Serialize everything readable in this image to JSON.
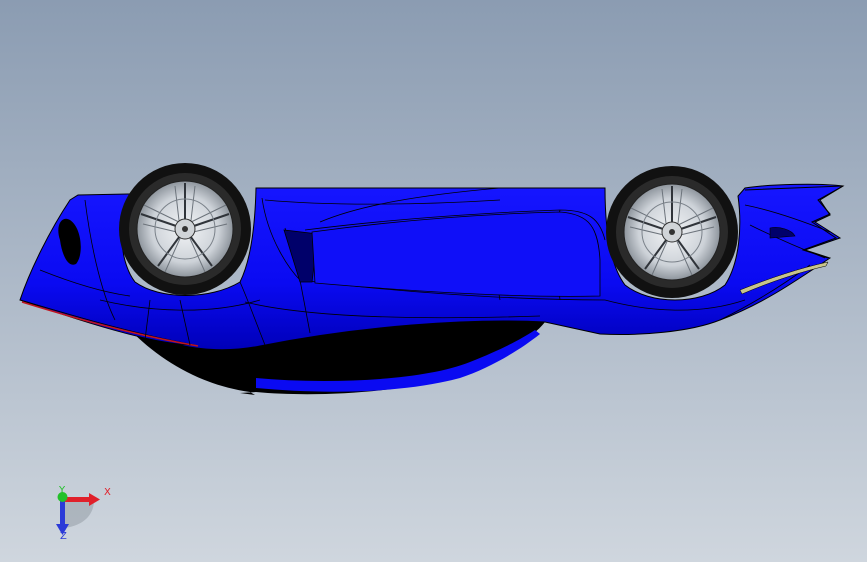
{
  "viewport": {
    "background_top": "#8b9cb2",
    "background_bottom": "#cfd6de",
    "model": {
      "name": "car-model",
      "body_color": "#0a0af2",
      "body_shadow": "#0000a6",
      "underside": "#000000",
      "edge_color": "#000000",
      "accent_line": "#c0141e",
      "side_strip": "#c8c48c",
      "tire_color": "#111111",
      "rim_color": "#d9dde2"
    }
  },
  "triad": {
    "x_label": "X",
    "y_label": "Y",
    "z_label": "Z",
    "x_color": "#e0202a",
    "y_color": "#22c02a",
    "z_color": "#2b3ad8"
  }
}
